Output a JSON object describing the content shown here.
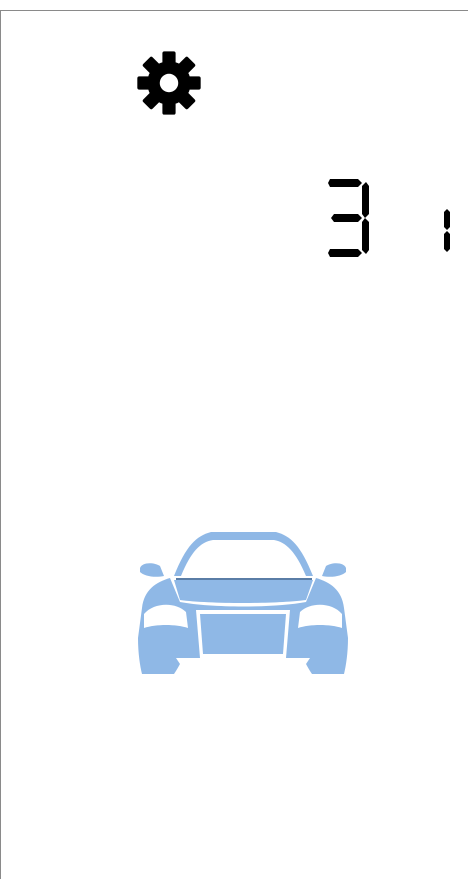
{
  "display": {
    "value": "3",
    "secondary_value": "1"
  },
  "icons": {
    "settings": "gear-icon",
    "vehicle": "car-icon"
  },
  "colors": {
    "icon": "#000000",
    "segment": "#000000",
    "car": "#8fb8e6",
    "background": "#ffffff"
  }
}
